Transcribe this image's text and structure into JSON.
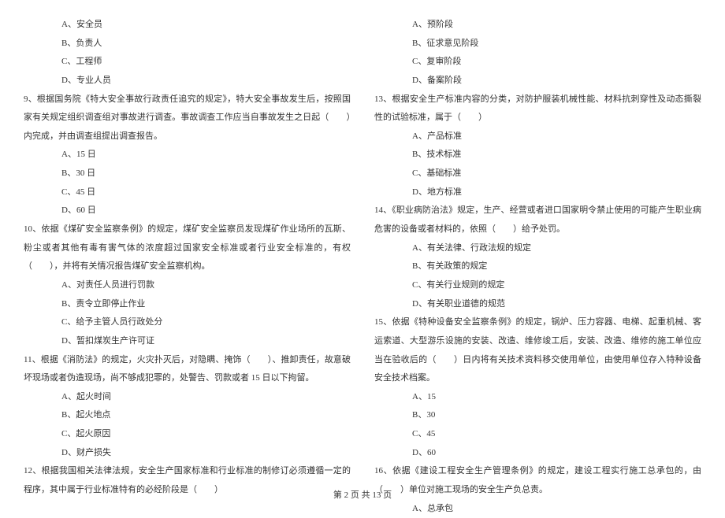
{
  "left": {
    "q8_options": {
      "a": "A、安全员",
      "b": "B、负责人",
      "c": "C、工程师",
      "d": "D、专业人员"
    },
    "q9": "9、根据国务院《特大安全事故行政责任追究的规定》，特大安全事故发生后，按照国家有关规定组织调查组对事故进行调查。事故调查工作应当自事故发生之日起（　　）内完成，并由调查组提出调查报告。",
    "q9_options": {
      "a": "A、15 日",
      "b": "B、30 日",
      "c": "C、45 日",
      "d": "D、60 日"
    },
    "q10": "10、依据《煤矿安全监察条例》的规定，煤矿安全监察员发现煤矿作业场所的瓦斯、粉尘或者其他有毒有害气体的浓度超过国家安全标准或者行业安全标准的，有权（　　），并将有关情况报告煤矿安全监察机构。",
    "q10_options": {
      "a": "A、对责任人员进行罚款",
      "b": "B、责令立即停止作业",
      "c": "C、给予主管人员行政处分",
      "d": "D、暂扣煤炭生产许可证"
    },
    "q11": "11、根据《消防法》的规定，火灾扑灭后，对隐瞒、掩饰（　　）、推卸责任，故意破坏现场或者伪造现场，尚不够成犯罪的，处警告、罚款或者 15 日以下拘留。",
    "q11_options": {
      "a": "A、起火时间",
      "b": "B、起火地点",
      "c": "C、起火原因",
      "d": "D、财产损失"
    },
    "q12": "12、根据我国相关法律法规，安全生产国家标准和行业标准的制修订必须遵循一定的程序，其中属于行业标准特有的必经阶段是（　　）"
  },
  "right": {
    "q12_options": {
      "a": "A、预阶段",
      "b": "B、征求意见阶段",
      "c": "C、复审阶段",
      "d": "D、备案阶段"
    },
    "q13": "13、根据安全生产标准内容的分类，对防护服装机械性能、材料抗刺穿性及动态撕裂性的试验标准，属于（　　）",
    "q13_options": {
      "a": "A、产品标准",
      "b": "B、技术标准",
      "c": "C、基础标准",
      "d": "D、地方标准"
    },
    "q14": "14、《职业病防治法》规定，生产、经营或者进口国家明令禁止使用的可能产生职业病危害的设备或者材料的，依照（　　）给予处罚。",
    "q14_options": {
      "a": "A、有关法律、行政法规的规定",
      "b": "B、有关政策的规定",
      "c": "C、有关行业规则的规定",
      "d": "D、有关职业道德的规范"
    },
    "q15": "15、依据《特种设备安全监察条例》的规定，锅炉、压力容器、电梯、起重机械、客运索道、大型游乐设施的安装、改造、维修竣工后，安装、改造、维修的施工单位应当在验收后的（　　）日内将有关技术资料移交使用单位，由使用单位存入特种设备安全技术档案。",
    "q15_options": {
      "a": "A、15",
      "b": "B、30",
      "c": "C、45",
      "d": "D、60"
    },
    "q16": "16、依据《建设工程安全生产管理条例》的规定，建设工程实行施工总承包的，由（　　）单位对施工现场的安全生产负总责。",
    "q16_options": {
      "a": "A、总承包"
    }
  },
  "footer": "第 2 页 共 13 页"
}
